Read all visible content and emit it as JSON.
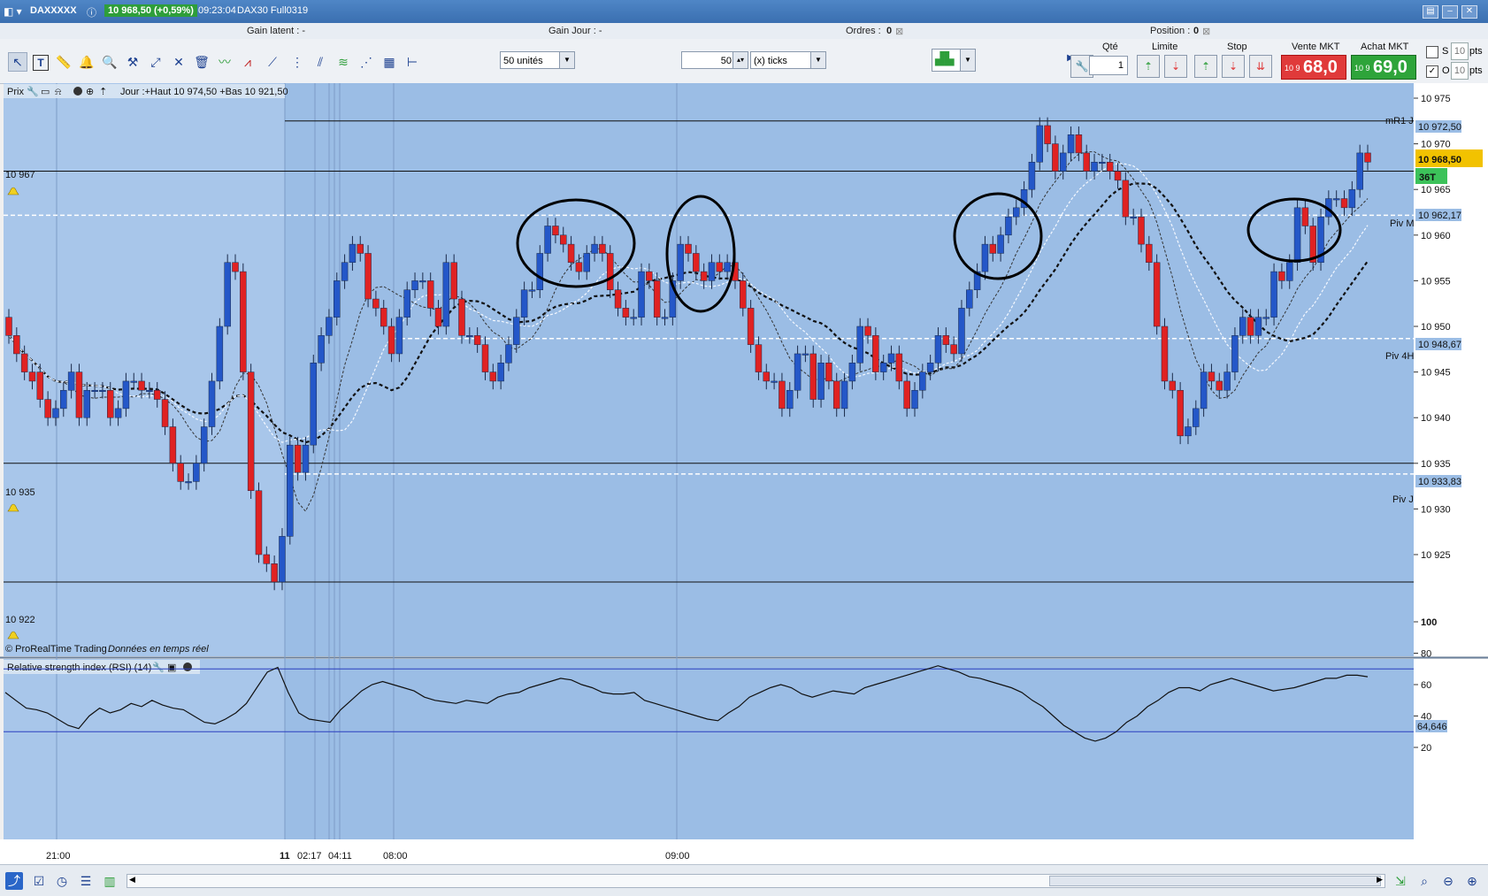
{
  "titlebar": {
    "instrument": "DAXXXXX",
    "quote": "10 968,50 (+0,59%)",
    "time": "09:23:04",
    "contract": "DAX30 Full0319"
  },
  "infobar": {
    "gain_latent": "Gain latent :  -",
    "gain_jour": "Gain Jour :  -",
    "ordres_label": "Ordres :",
    "ordres_value": "0",
    "position_label": "Position :",
    "position_value": "0"
  },
  "toolbar": {
    "tools": [
      "cursor-icon",
      "text-icon",
      "ruler-icon",
      "bell-icon",
      "zoom-icon",
      "hammer-icon",
      "trendline-icon",
      "crossline-icon",
      "trash-icon",
      "pattern-icon",
      "triangle-icon",
      "channel-icon",
      "vertical-line-icon",
      "parallel-lines-icon",
      "fibonacci-icon",
      "fan-icon",
      "horizontal-line-icon"
    ],
    "units_select": "50 unités",
    "ticks_value": "50",
    "ticks_select": "(x) ticks"
  },
  "order_panel": {
    "qty_label": "Qté",
    "qty_value": "1",
    "limit_label": "Limite",
    "stop_label": "Stop",
    "sell_label": "Vente MKT",
    "buy_label": "Achat MKT",
    "sell_small": "10 9",
    "sell_big": "68,0",
    "buy_small": "10 9",
    "buy_big": "69,0",
    "s_label": "S",
    "o_label": "O",
    "s_pts": "10",
    "o_pts": "10",
    "pts_label": "pts"
  },
  "price_panel": {
    "header_prefix": "Prix",
    "header_info": "Jour :+Haut 10 974,50 +Bas 10 921,50",
    "footer": "© ProRealTime Trading",
    "footer_italic": "Données en temps réel",
    "level_labels": [
      "10 967",
      "10 935",
      "10 922"
    ],
    "line_labels": {
      "mr1": "mR1 J",
      "pivm": "Piv M",
      "piv4h": "Piv 4H",
      "pivj": "Piv J"
    },
    "badges": {
      "mr1": "10 972,50",
      "pivm": "10 962,17",
      "piv4h": "10 948,67",
      "pivj": "10 933,83",
      "last": "10 968,50",
      "ticks": "36T"
    }
  },
  "rsi_panel": {
    "header": "Relative strength index (RSI) (14)",
    "value_badge": "64,646"
  },
  "time_axis": [
    "21:00",
    "11",
    "02:17",
    "04:11",
    "08:00",
    "09:00"
  ],
  "colors": {
    "chart_bg": "#9bbde5",
    "up": "#2457c8",
    "down": "#e02222",
    "sell": "#e03a3a",
    "buy": "#2ea43a"
  },
  "chart_data": [
    {
      "type": "candlestick",
      "title": "DAX30 Full0319",
      "y_ticks": [
        10925,
        10930,
        10935,
        10940,
        10945,
        10950,
        10955,
        10960,
        10965,
        10970,
        10975
      ],
      "ylim": [
        10918.5,
        10976.5
      ],
      "open": [
        10951,
        10949,
        10947,
        10945,
        10945,
        10942,
        10940,
        10941,
        10943,
        10945,
        10940,
        10943,
        10943,
        10943,
        10940,
        10941,
        10944,
        10944,
        10943,
        10943,
        10942,
        10939,
        10935,
        10933,
        10933,
        10935,
        10939,
        10944,
        10950,
        10957,
        10956,
        10945,
        10932,
        10925,
        10924,
        10922,
        10927,
        10937,
        10934,
        10937,
        10946,
        10949,
        10951,
        10955,
        10957,
        10959,
        10958,
        10953,
        10952,
        10950,
        10947,
        10951,
        10954,
        10955,
        10955,
        10952,
        10950,
        10957,
        10953,
        10949,
        10949,
        10948,
        10945,
        10944,
        10946,
        10948,
        10951,
        10954,
        10954,
        10958,
        10961,
        10960,
        10959,
        10957,
        10956,
        10958,
        10959,
        10958,
        10954,
        10952,
        10951,
        10951,
        10956,
        10955,
        10951,
        10951,
        10955,
        10959,
        10958,
        10956,
        10955,
        10957,
        10956,
        10957,
        10955,
        10952,
        10948,
        10945,
        10944,
        10944,
        10941,
        10943,
        10947,
        10947,
        10942,
        10946,
        10944,
        10941,
        10944,
        10946,
        10950,
        10949,
        10945,
        10946,
        10947,
        10944,
        10941,
        10943,
        10945,
        10946,
        10949,
        10948,
        10947,
        10952,
        10954,
        10956,
        10959,
        10958,
        10960,
        10962,
        10963,
        10965,
        10968,
        10972,
        10970,
        10967,
        10969,
        10971,
        10969,
        10967,
        10968,
        10968,
        10967,
        10966,
        10962,
        10962,
        10959,
        10957,
        10950,
        10944,
        10943,
        10938,
        10939,
        10941,
        10945,
        10944,
        10943,
        10945,
        10949,
        10951,
        10949,
        10951,
        10951,
        10956,
        10955,
        10957,
        10963,
        10961,
        10957,
        10962,
        10964,
        10964,
        10963,
        10965,
        10969
      ],
      "close": [
        10949,
        10947,
        10945,
        10944,
        10942,
        10940,
        10941,
        10943,
        10945,
        10940,
        10943,
        10943,
        10943,
        10940,
        10941,
        10944,
        10944,
        10943,
        10943,
        10942,
        10939,
        10935,
        10933,
        10933,
        10935,
        10939,
        10944,
        10950,
        10957,
        10956,
        10945,
        10932,
        10925,
        10924,
        10922,
        10927,
        10937,
        10934,
        10937,
        10946,
        10949,
        10951,
        10955,
        10957,
        10959,
        10958,
        10953,
        10952,
        10950,
        10947,
        10951,
        10954,
        10955,
        10955,
        10952,
        10950,
        10957,
        10953,
        10949,
        10949,
        10948,
        10945,
        10944,
        10946,
        10948,
        10951,
        10954,
        10954,
        10958,
        10961,
        10960,
        10959,
        10957,
        10956,
        10958,
        10959,
        10958,
        10954,
        10952,
        10951,
        10951,
        10956,
        10955,
        10951,
        10951,
        10955,
        10959,
        10958,
        10956,
        10955,
        10957,
        10956,
        10957,
        10955,
        10952,
        10948,
        10945,
        10944,
        10944,
        10941,
        10943,
        10947,
        10947,
        10942,
        10946,
        10944,
        10941,
        10944,
        10946,
        10950,
        10949,
        10945,
        10946,
        10947,
        10944,
        10941,
        10943,
        10945,
        10946,
        10949,
        10948,
        10947,
        10952,
        10954,
        10956,
        10959,
        10958,
        10960,
        10962,
        10963,
        10965,
        10968,
        10972,
        10970,
        10967,
        10969,
        10971,
        10969,
        10967,
        10968,
        10968,
        10967,
        10966,
        10962,
        10962,
        10959,
        10957,
        10950,
        10944,
        10943,
        10938,
        10939,
        10941,
        10945,
        10944,
        10943,
        10945,
        10949,
        10951,
        10949,
        10951,
        10951,
        10956,
        10955,
        10957,
        10963,
        10961,
        10957,
        10962,
        10964,
        10964,
        10963,
        10965,
        10969,
        10968
      ]
    },
    {
      "type": "line",
      "title": "Relative strength index (RSI) (14)",
      "y_ticks": [
        20,
        40,
        60,
        80,
        100
      ],
      "ylim": [
        0,
        104
      ],
      "levels": [
        70,
        30
      ],
      "values": [
        55,
        50,
        45,
        44,
        42,
        38,
        34,
        32,
        40,
        45,
        42,
        44,
        48,
        46,
        50,
        47,
        45,
        44,
        40,
        36,
        35,
        38,
        42,
        48,
        58,
        68,
        71,
        55,
        42,
        38,
        37,
        36,
        44,
        50,
        56,
        60,
        62,
        60,
        58,
        56,
        52,
        50,
        49,
        48,
        50,
        49,
        48,
        52,
        54,
        55,
        58,
        60,
        62,
        64,
        63,
        60,
        58,
        55,
        54,
        54,
        55,
        50,
        48,
        46,
        44,
        42,
        40,
        38,
        37,
        42,
        46,
        52,
        55,
        58,
        60,
        58,
        54,
        52,
        54,
        56,
        55,
        54,
        58,
        60,
        62,
        64,
        66,
        68,
        70,
        72,
        70,
        68,
        65,
        64,
        62,
        60,
        58,
        55,
        50,
        46,
        40,
        34,
        30,
        26,
        24,
        26,
        30,
        36,
        40,
        46,
        50,
        55,
        58,
        58,
        56,
        60,
        62,
        64,
        62,
        60,
        58,
        56,
        57,
        58,
        60,
        62,
        64,
        64,
        66,
        66,
        65
      ],
      "value_label": "64,646"
    }
  ]
}
